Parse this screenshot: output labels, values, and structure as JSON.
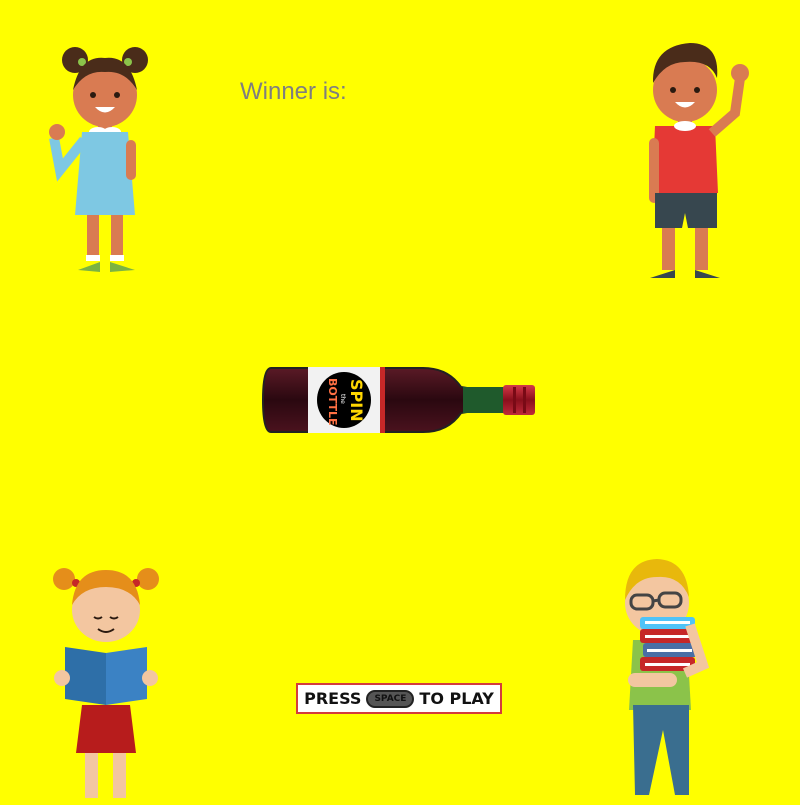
{
  "status": {
    "winner_label": "Winner is:"
  },
  "bottle": {
    "label_line1": "SPIN",
    "label_line2": "the",
    "label_line3": "BOTTLE"
  },
  "prompt": {
    "press_text": "PRESS",
    "key_text": "SPACE",
    "to_play_text": "TO PLAY"
  },
  "colors": {
    "background": "#ffff00",
    "winner_text": "#7f7f7f",
    "prompt_border": "#d43c3c",
    "bottle_glass": "#3a0a14",
    "bottle_cap": "#b01a2a"
  },
  "players": [
    {
      "name": "girl-waving",
      "icon": "girl-waving-icon"
    },
    {
      "name": "boy-waving",
      "icon": "boy-waving-icon"
    },
    {
      "name": "girl-reading",
      "icon": "girl-reading-book-icon"
    },
    {
      "name": "boy-with-books",
      "icon": "boy-carrying-books-icon"
    }
  ]
}
